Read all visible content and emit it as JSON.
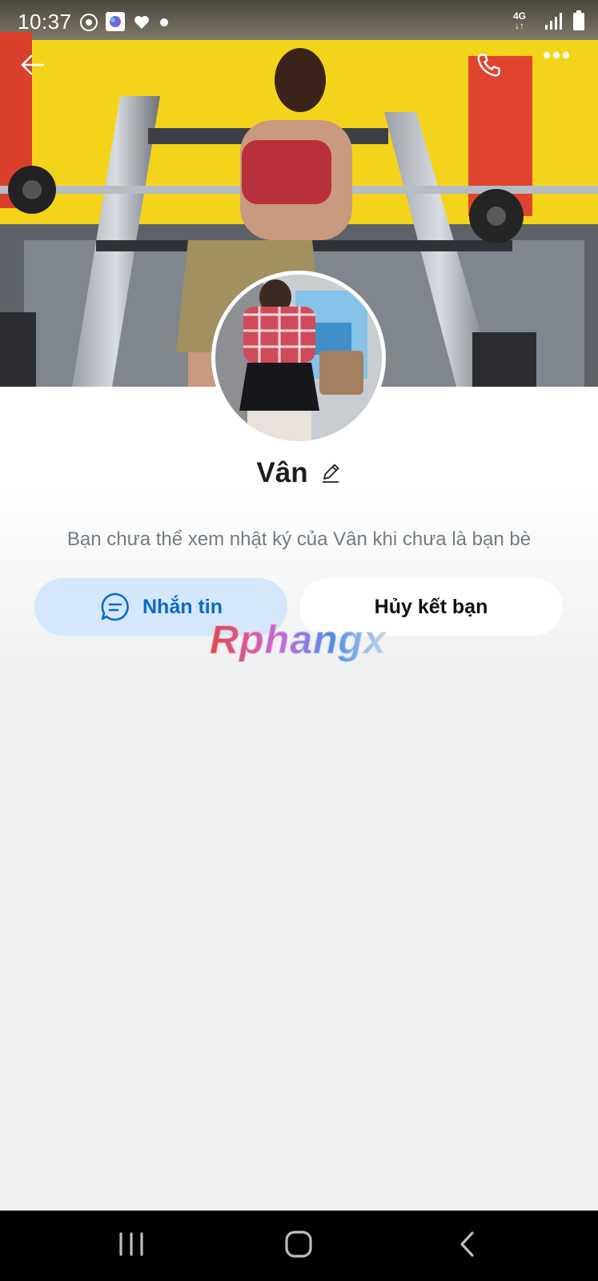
{
  "status_bar": {
    "time": "10:37",
    "network": "4G",
    "icons": [
      "chrome-icon",
      "app-icon",
      "heart-icon",
      "dot-icon",
      "signal-icon",
      "battery-icon"
    ]
  },
  "top_nav": {
    "back_icon": "arrow-left-icon",
    "call_icon": "phone-icon",
    "more_icon": "more-horizontal-icon"
  },
  "profile": {
    "name": "Vân",
    "edit_icon": "pencil-icon",
    "notice": "Bạn chưa thể xem nhật ký của Vân khi chưa là bạn bè"
  },
  "actions": {
    "message_label": "Nhắn tin",
    "message_icon": "chat-bubble-icon",
    "unfriend_label": "Hủy kết bạn"
  },
  "watermark": "Rphangx",
  "system_nav": {
    "recents_icon": "recents-icon",
    "home_icon": "home-icon",
    "back_icon": "back-chevron-icon"
  },
  "colors": {
    "accent": "#0a68d0",
    "message_button_bg": "#d4e7fb",
    "page_bg": "#eef0f2"
  }
}
